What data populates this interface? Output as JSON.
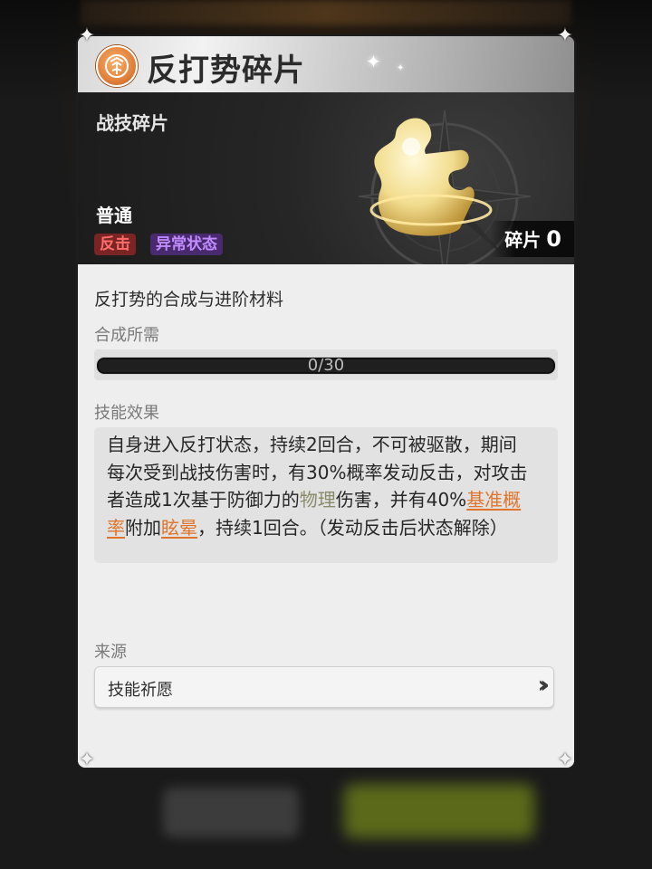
{
  "item": {
    "name": "反打势碎片",
    "category": "战技碎片",
    "rarity": "普通",
    "tags": [
      "反击",
      "异常状态"
    ],
    "shard_label": "碎片",
    "shard_count": "0",
    "description": "反打势的合成与进阶材料"
  },
  "synthesis": {
    "label": "合成所需",
    "progress_text": "0/30",
    "progress_fraction": 0
  },
  "effect": {
    "label": "技能效果",
    "text_parts": [
      "自身进入反打状态，持续2回合，不可被驱散，期间每次受到战技伤害时，有30%概率发动反击，对攻击者造成1次基于防御力的",
      "物理",
      "伤害，并有40%",
      "基准概率",
      "附加",
      "眩晕",
      "，持续1回合。（发动反击后状态解除）"
    ]
  },
  "source": {
    "label": "来源",
    "button_label": "技能祈愿"
  },
  "colors": {
    "highlight_orange": "#e0742b",
    "highlight_physical": "#8a8a6a",
    "tag_counter": "#ff6d6d",
    "tag_status": "#c28cff",
    "badge_orange": "#e1813c"
  },
  "icons": {
    "title_badge": "skill-emblem-icon",
    "item_art": "puzzle-shard-icon",
    "source_arrow": "double-chevron-right-icon",
    "corner": "corner-ornament-icon"
  }
}
